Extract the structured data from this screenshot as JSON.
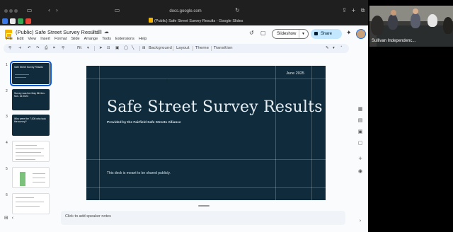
{
  "browser": {
    "url": "docs.google.com",
    "tab_title": "(Public) Safe Street Survey Results - Google Slides"
  },
  "doc": {
    "title": "(Public) Safe Street Survey Results",
    "menu": [
      "File",
      "Edit",
      "View",
      "Insert",
      "Format",
      "Slide",
      "Arrange",
      "Tools",
      "Extensions",
      "Help"
    ],
    "slideshow_label": "Slideshow",
    "share_label": "Share"
  },
  "toolbar": {
    "zoom": "Fit",
    "background_label": "Background",
    "layout_label": "Layout",
    "theme_label": "Theme",
    "transition_label": "Transition"
  },
  "filmstrip": {
    "thumbs": [
      {
        "num": "1",
        "text": "Safe Street Survey Results"
      },
      {
        "num": "2",
        "text": "Survey was live May 8th thru Nov. 16 2024"
      },
      {
        "num": "3",
        "text": "Who were the 7,000 who took the survey?"
      },
      {
        "num": "4",
        "text": ""
      },
      {
        "num": "5",
        "text": ""
      },
      {
        "num": "6",
        "text": ""
      }
    ]
  },
  "slide": {
    "date": "June 2025",
    "title": "Safe Street Survey Results",
    "subtitle": "Provided by the Fairfield Safe Streets Alliance",
    "note": "This deck is meant to be shared publicly."
  },
  "notes": {
    "placeholder": "Click to add speaker notes"
  },
  "video": {
    "label": "Sullivan Independenc..."
  },
  "colors": {
    "slide_bg": "#0f2b3c",
    "share_bg": "#c2e7ff",
    "slides_brand": "#f4b400"
  }
}
